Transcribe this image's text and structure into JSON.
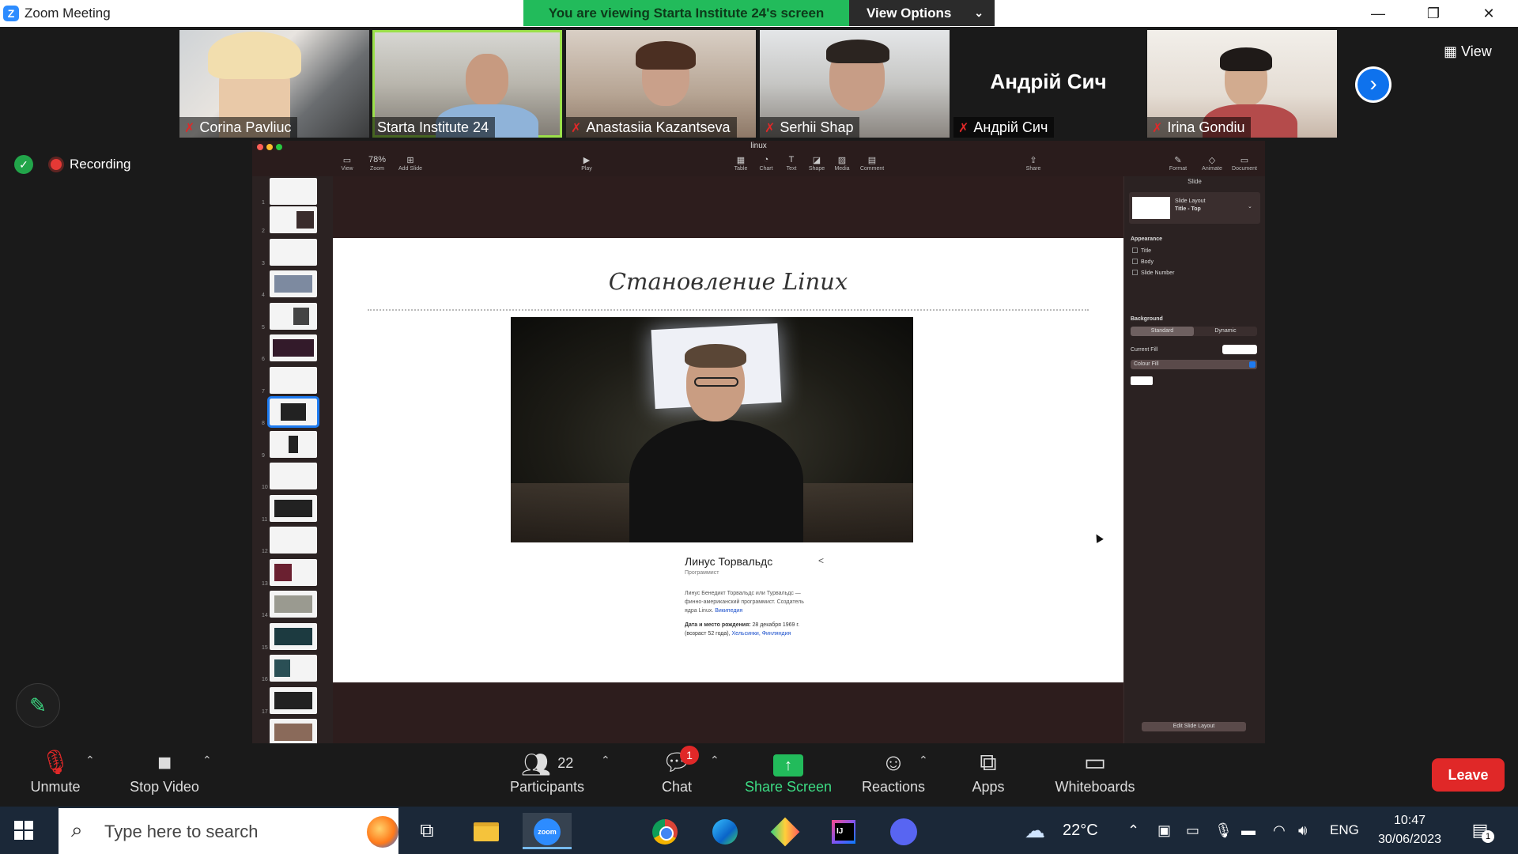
{
  "window": {
    "title": "Zoom Meeting",
    "app_icon": "Z",
    "controls": {
      "minimize": "—",
      "restore": "❐",
      "close": "✕"
    }
  },
  "share_banner": {
    "text": "You are viewing Starta Institute 24's screen",
    "view_options": "View Options",
    "color": "#22bb5b"
  },
  "participants_strip": [
    {
      "name": "Corina Pavliuc",
      "muted": true,
      "video": true
    },
    {
      "name": "Starta Institute 24",
      "muted": false,
      "video": true,
      "active_speaker": true
    },
    {
      "name": "Anastasiia Kazantseva",
      "muted": true,
      "video": true
    },
    {
      "name": "Serhii Shap",
      "muted": true,
      "video": true
    },
    {
      "name": "Андрій Сич",
      "muted": true,
      "video": false,
      "display_name": "Андрій Сич"
    },
    {
      "name": "Irina Gondiu",
      "muted": true,
      "video": true
    }
  ],
  "view_button": "View",
  "recording": {
    "label": "Recording"
  },
  "keynote": {
    "doc_title": "linux",
    "toolbar": [
      "View",
      "Zoom",
      "Add Slide",
      "Play",
      "Table",
      "Chart",
      "Text",
      "Shape",
      "Media",
      "Comment",
      "Share",
      "Format",
      "Animate",
      "Document"
    ],
    "zoom_value": "78%",
    "slide_numbers": [
      "1",
      "2",
      "3",
      "4",
      "5",
      "6",
      "7",
      "8",
      "9",
      "10",
      "11",
      "12",
      "13",
      "14",
      "15",
      "16",
      "17"
    ],
    "selected_slide": 8,
    "slide": {
      "title": "Становление Linux",
      "person_name": "Линус Торвальдс",
      "person_role": "Программист",
      "description": "Линус Бенедикт Торвальдс или Турвальдс — финно-американский программист. Создатель ядра Linux.",
      "description_link": "Википедия",
      "birth_label": "Дата и место рождения:",
      "birth_value": "28 декабря 1969 г. (возраст 52 года),",
      "birth_link": "Хельсинки, Финляндия"
    },
    "inspector": {
      "header": "Slide",
      "layout_label": "Slide Layout",
      "layout_value": "Title - Top",
      "appearance": "Appearance",
      "appearance_items": [
        "Title",
        "Body",
        "Slide Number"
      ],
      "background": "Background",
      "bg_modes": [
        "Standard",
        "Dynamic"
      ],
      "current_fill": "Current Fill",
      "fill_type": "Colour Fill",
      "edit_layout": "Edit Slide Layout"
    }
  },
  "controls": {
    "unmute": "Unmute",
    "stop_video": "Stop Video",
    "participants": "Participants",
    "participants_count": "22",
    "chat": "Chat",
    "chat_badge": "1",
    "share_screen": "Share Screen",
    "reactions": "Reactions",
    "apps": "Apps",
    "whiteboards": "Whiteboards",
    "leave": "Leave"
  },
  "taskbar": {
    "search_placeholder": "Type here to search",
    "weather": "22°C",
    "language": "ENG",
    "time": "10:47",
    "date": "30/06/2023",
    "notifications": "1",
    "zoom_label": "zoom"
  }
}
